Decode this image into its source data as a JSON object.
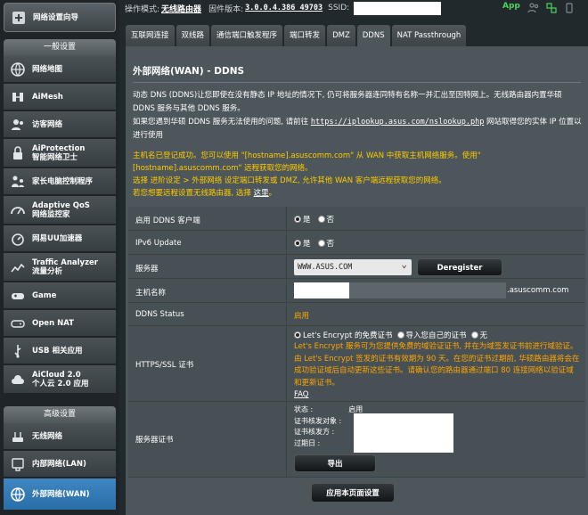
{
  "sidebar": {
    "qis_label": "网络设置向导",
    "general_header": "一般设置",
    "general_items": [
      {
        "name": "network-map",
        "label": "网络地图"
      },
      {
        "name": "aimesh",
        "label": "AiMesh"
      },
      {
        "name": "guest-network",
        "label": "访客网络"
      },
      {
        "name": "aiprotection",
        "label": "AiProtection",
        "sub": "智能网络卫士"
      },
      {
        "name": "parental-control",
        "label": "家长电脑控制程序"
      },
      {
        "name": "adaptive-qos",
        "label": "Adaptive QoS",
        "sub": "网络监控家"
      },
      {
        "name": "uu-accelerator",
        "label": "网易UU加速器"
      },
      {
        "name": "traffic-analyzer",
        "label": "Traffic Analyzer",
        "sub": "流量分析"
      },
      {
        "name": "game",
        "label": "Game"
      },
      {
        "name": "open-nat",
        "label": "Open NAT"
      },
      {
        "name": "usb-apps",
        "label": "USB 相关应用"
      },
      {
        "name": "aicloud",
        "label": "AiCloud 2.0",
        "sub": "个人云 2.0 应用"
      }
    ],
    "advanced_header": "高级设置",
    "advanced_items": [
      {
        "name": "wireless",
        "label": "无线网络"
      },
      {
        "name": "lan",
        "label": "内部网络(LAN)"
      },
      {
        "name": "wan",
        "label": "外部网络(WAN)"
      }
    ]
  },
  "topbar": {
    "mode_label": "操作模式:",
    "mode_value": "无线路由器",
    "firmware_label": "固件版本:",
    "firmware_value": "3.0.0.4.386_49703",
    "ssid_label": "SSID:",
    "app_label": "App"
  },
  "tabs": [
    "互联网连接",
    "双线路",
    "通信端口触发程序",
    "端口转发",
    "DMZ",
    "DDNS",
    "NAT Passthrough"
  ],
  "page": {
    "title": "外部网络(WAN) - DDNS",
    "desc1": "动态 DNS (DDNS)让您即使在没有静态 IP 地址的情况下, 仍可将服务器连同特有名称一并汇出至因特网上。无线路由器内置华硕 DDNS 服务与其他 DDNS 服务。",
    "desc2_prefix": "如果您遇到华硕 DDNS 服务无法使用的问题, 请前往",
    "desc2_link": "https://iplookup.asus.com/nslookup.php",
    "desc2_suffix": "网站取得您的实体 IP 位置以进行使用",
    "warn1": "主机名已登记成功。您可以使用 \"[hostname].asuscomm.com\" 从 WAN 中获取主机网络服务。使用\"[hostname].asuscomm.com\" 远程获取您的网络。",
    "warn2": "选择 进阶设定 > 外部网络 设定端口转发或 DMZ, 允许其他 WAN 客户端远程获取您的网络。",
    "warn3_prefix": "若您想要远程设置无线路由器, 选择",
    "warn3_link": "这里",
    "warn3_suffix": "。"
  },
  "form": {
    "enable_label": "启用 DDNS 客户端",
    "ipv6_label": "IPv6 Update",
    "yes": "是",
    "no": "否",
    "server_label": "服务器",
    "server_value": "WWW.ASUS.COM",
    "deregister_label": "Deregister",
    "host_label": "主机名称",
    "host_suffix": ".asuscomm.com",
    "status_label": "DDNS Status",
    "status_value": "启用",
    "ssl_label": "HTTPS/SSL 证书",
    "ssl_opt1": "Let's Encrypt 的免费证书",
    "ssl_opt2": "导入您自己的证书",
    "ssl_opt3": "无",
    "ssl_desc": "Let's Encrypt 服务可为您提供免费的域验证证书, 并在为域签发证书前进行域验证。由 Let's Encrypt 签发的证书有效期为 90 天。在您的证书过期前, 华硕路由器将会在成功验证域后自动更新这些证书。请确认您的路由器通过端口 80 连接网络以验证域和更新证书。",
    "faq": "FAQ",
    "cert_label": "服务器证书",
    "cert_status_label": "状态 :",
    "cert_status_value": "启用",
    "cert_issued_to": "证书核发对象 :",
    "cert_issued_by": "证书核发方 :",
    "cert_expire": "过期日 :",
    "export_label": "导出",
    "apply_label": "应用本页面设置"
  },
  "colors": {
    "accent_blue": "#2a6ea6",
    "warning": "#ffcc00",
    "orange": "#ffa500",
    "app_green": "#4ad45a"
  }
}
